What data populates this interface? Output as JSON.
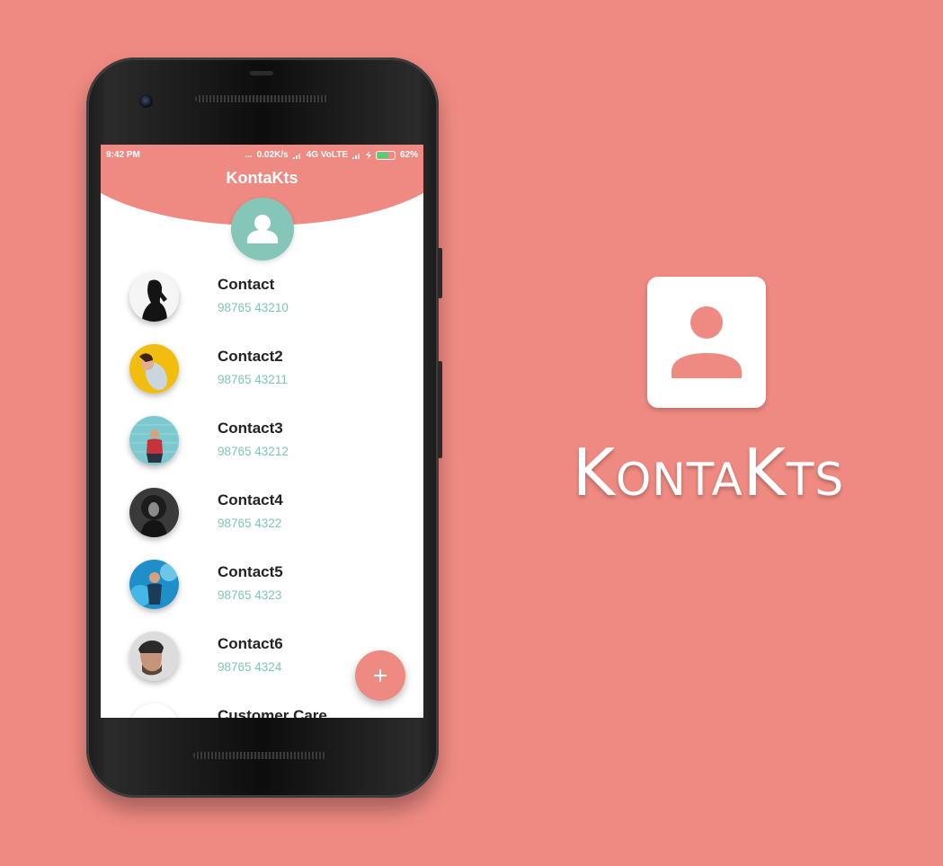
{
  "colors": {
    "background": "#ef8a82",
    "accent": "#ef8a82",
    "teal": "#85c6b8",
    "number": "#7fc4b8"
  },
  "status_bar": {
    "time": "9:42 PM",
    "dots": "...",
    "speed": "0.02K/s",
    "network": "4G VoLTE",
    "battery": "62%",
    "battery_level": 0.62
  },
  "app": {
    "title": "KontaKts",
    "header_icon": "person-icon",
    "fab_icon": "plus-icon"
  },
  "contacts": [
    {
      "name": "Contact",
      "number": "98765 43210"
    },
    {
      "name": "Contact2",
      "number": "98765 43211"
    },
    {
      "name": "Contact3",
      "number": "98765 43212"
    },
    {
      "name": "Contact4",
      "number": "98765 4322"
    },
    {
      "name": "Contact5",
      "number": "98765 4323"
    },
    {
      "name": "Contact6",
      "number": "98765 4324"
    },
    {
      "name": "Customer Care",
      "number": ""
    }
  ],
  "brand": {
    "logo_icon": "contact-card-icon",
    "name": "KontaKts"
  }
}
